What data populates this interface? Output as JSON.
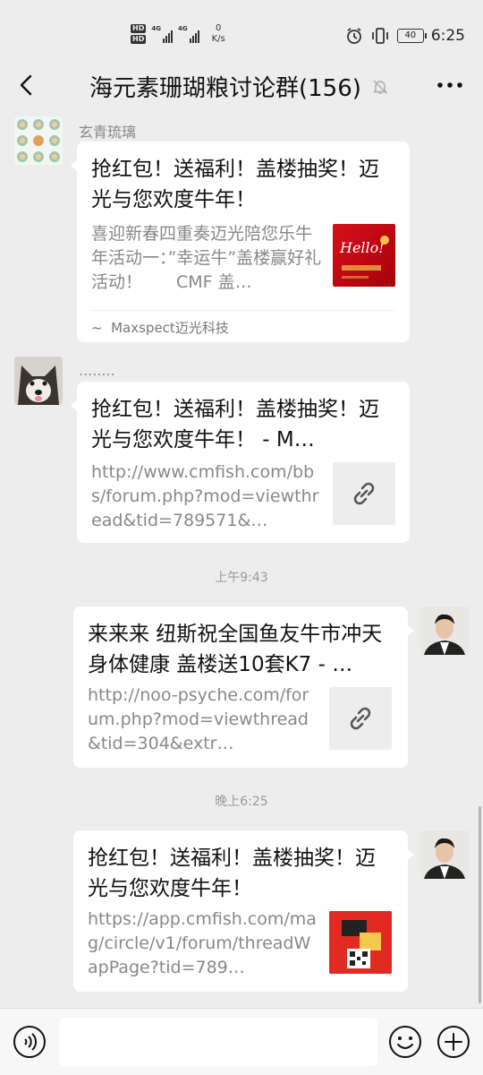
{
  "status": {
    "speed_value": "0",
    "speed_unit": "K/s",
    "battery": "40",
    "time": "6:25"
  },
  "header": {
    "title": "海元素珊瑚粮讨论群(156)"
  },
  "messages": [
    {
      "sender": "玄青琉璃",
      "title": "抢红包！送福利！盖楼抽奖！迈光与您欢度牛年！",
      "desc": "喜迎新春四重奏迈光陪您乐牛年活动一：”幸运牛”盖楼赢好礼活动！　　CMF 盖…",
      "thumb_text": "Hello!",
      "footer": "Maxspect迈光科技"
    },
    {
      "sender": "........",
      "title": "抢红包！送福利！盖楼抽奖！迈光与您欢度牛年！ - M…",
      "desc": "http://www.cmfish.com/bbs/forum.php?mod=viewthread&tid=789571&…"
    },
    {
      "time": "上午9:43",
      "title": "来来来 纽斯祝全国鱼友牛市冲天 身体健康 盖楼送10套K7 - …",
      "desc": "http://noo-psyche.com/forum.php?mod=viewthread&tid=304&extr…"
    },
    {
      "time": "晚上6:25",
      "title": "抢红包！送福利！盖楼抽奖！迈光与您欢度牛年！",
      "desc": "https://app.cmfish.com/mag/circle/v1/forum/threadWapPage?tid=789…"
    }
  ]
}
